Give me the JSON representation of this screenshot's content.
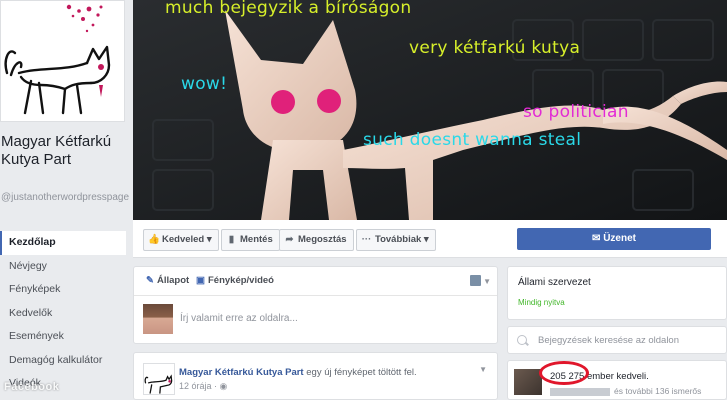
{
  "page": {
    "name": "Magyar Kétfarkú Kutya Part",
    "username": "@justanotherwordpresspage"
  },
  "nav": [
    {
      "label": "Kezdőlap",
      "active": true
    },
    {
      "label": "Névjegy"
    },
    {
      "label": "Fényképek"
    },
    {
      "label": "Kedvelők"
    },
    {
      "label": "Események"
    },
    {
      "label": "Demagóg kalkulátor"
    },
    {
      "label": "Videók"
    }
  ],
  "cover": {
    "lines": [
      {
        "text": "much bejegyzik a bíróságon",
        "color": "#d7ef2a"
      },
      {
        "text": "very kétfarkú kutya",
        "color": "#d7ef2a"
      },
      {
        "text": "wow!",
        "color": "#2ad8e8"
      },
      {
        "text": "so politician",
        "color": "#e22bd4"
      },
      {
        "text": "such doesnt wanna steal",
        "color": "#2ad8e8"
      }
    ]
  },
  "actions": {
    "like": "Kedveled",
    "save": "Mentés",
    "share": "Megosztás",
    "more": "Továbbiak",
    "message": "Üzenet"
  },
  "composer": {
    "status_tab": "Állapot",
    "photo_tab": "Fénykép/videó",
    "placeholder": "Írj valamit erre az oldalra..."
  },
  "post": {
    "author": "Magyar Kétfarkú Kutya Part",
    "action_text": "egy új fényképet töltött fel.",
    "time": "12 órája"
  },
  "about": {
    "category": "Állami szervezet",
    "status": "Mindig nyitva"
  },
  "search": {
    "placeholder": "Bejegyzések keresése az oldalon"
  },
  "likes": {
    "count": "205 275",
    "suffix": "ember kedveli.",
    "friends": "és további 136 ismerős"
  },
  "watermark": "Facebook",
  "colors": {
    "accent": "#4267b2",
    "link": "#365899",
    "open_status": "#42b72a",
    "highlight": "#e0162b"
  }
}
